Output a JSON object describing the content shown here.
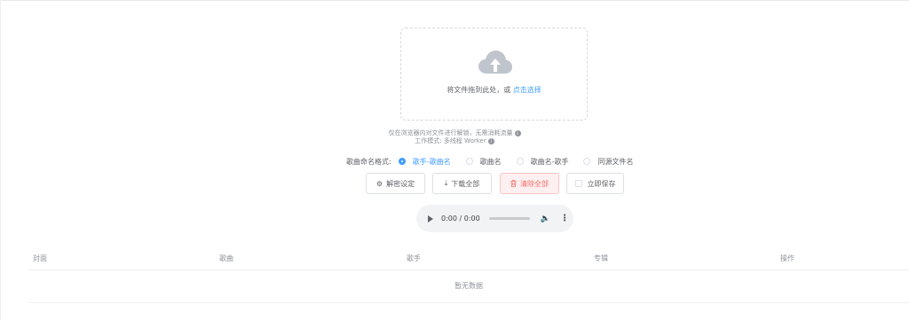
{
  "upload": {
    "text": "将文件拖到此处，或 ",
    "link": "点击选择"
  },
  "tips": {
    "line1": "仅在浏览器内对文件进行解锁，无需消耗流量",
    "line2": "工作模式: 多线程 Worker",
    "info_glyph": "i"
  },
  "naming": {
    "label": "歌曲命名格式:",
    "options": [
      "歌手-歌曲名",
      "歌曲名",
      "歌曲名-歌手",
      "同源文件名"
    ],
    "selected_index": 0
  },
  "toolbar": {
    "decrypt_settings": "解密设定",
    "download_all": "下载全部",
    "clear_all": "清除全部",
    "save_immediately": "立即保存"
  },
  "player": {
    "time": "0:00 / 0:00"
  },
  "table": {
    "headers": [
      "封面",
      "歌曲",
      "歌手",
      "专辑",
      "操作"
    ],
    "empty_text": "暂无数据"
  }
}
